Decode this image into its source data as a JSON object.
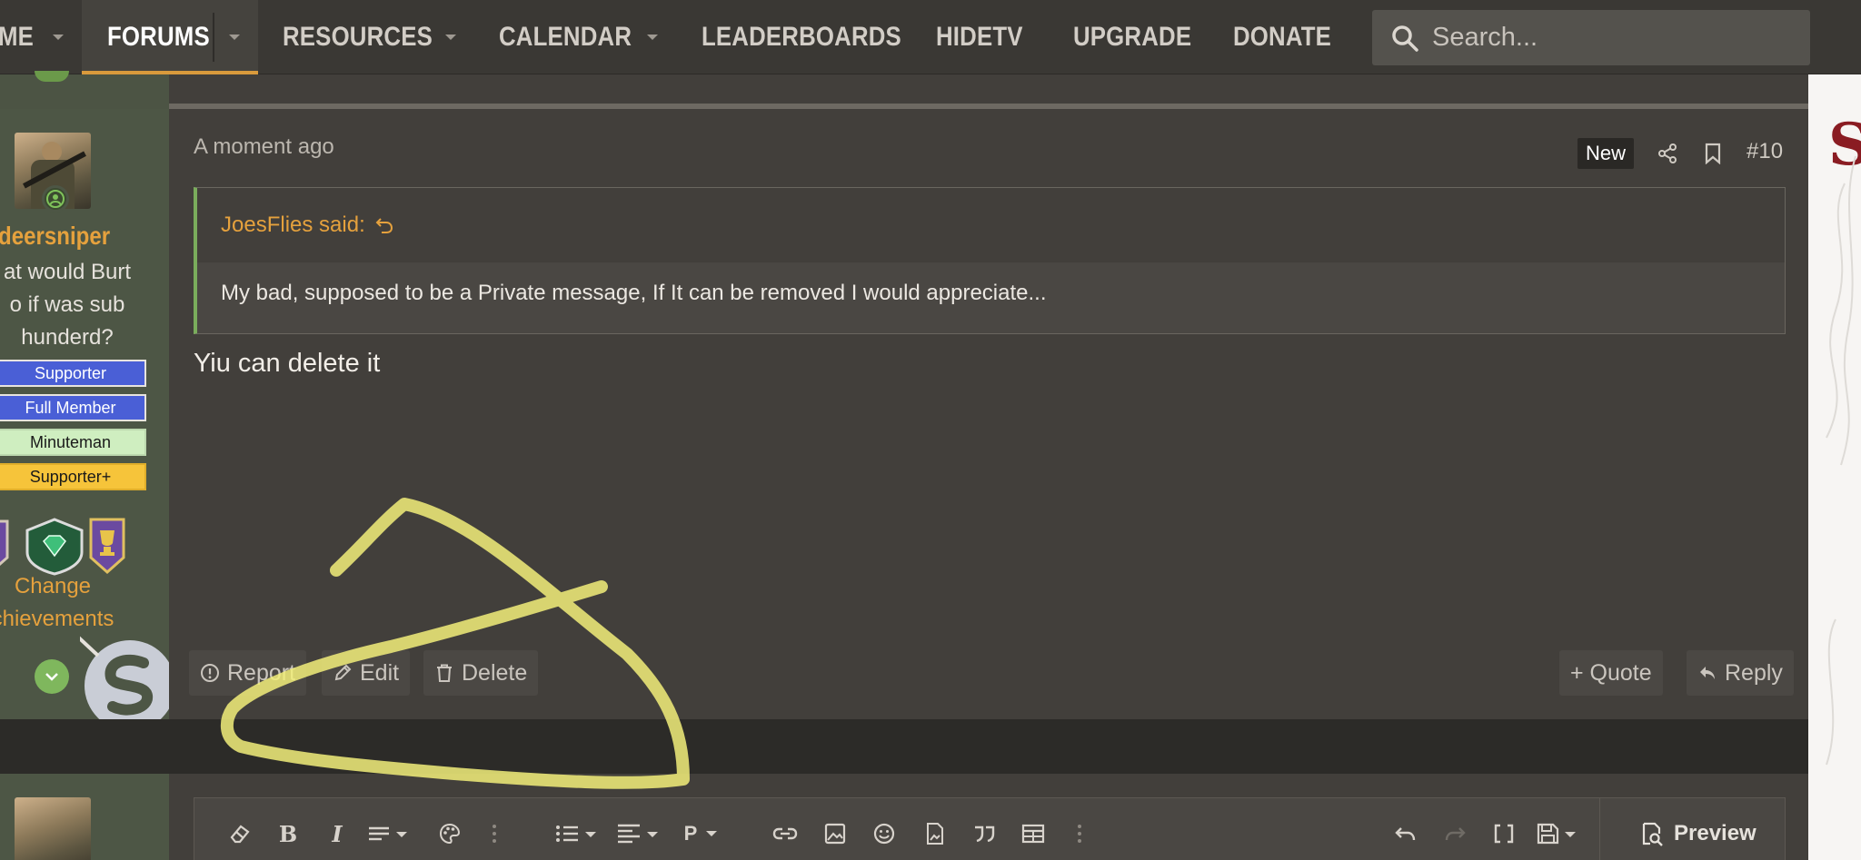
{
  "nav": {
    "items": [
      {
        "label": "ME"
      },
      {
        "label": "FORUMS"
      },
      {
        "label": "RESOURCES"
      },
      {
        "label": "CALENDAR"
      },
      {
        "label": "LEADERBOARDS"
      },
      {
        "label": "HIDETV"
      },
      {
        "label": "UPGRADE"
      },
      {
        "label": "DONATE"
      }
    ],
    "search_placeholder": "Search..."
  },
  "user": {
    "username": "deersniper",
    "title_lines": [
      "at would Burt",
      "o if was sub",
      "hunderd?"
    ],
    "banners": [
      {
        "label": "Supporter",
        "style": "blue"
      },
      {
        "label": "Full Member",
        "style": "blue"
      },
      {
        "label": "Minuteman",
        "style": "green"
      },
      {
        "label": "Supporter+",
        "style": "yellow"
      }
    ],
    "change_achievements_lines": [
      "Change",
      "chievements"
    ]
  },
  "post": {
    "timestamp": "A moment ago",
    "new_badge": "New",
    "number": "#10",
    "quote": {
      "author": "JoesFlies said:",
      "text": "My bad, supposed to be a Private message, If It can be removed I would appreciate..."
    },
    "message": "Yiu can delete it",
    "actions": {
      "report": "Report",
      "edit": "Edit",
      "delete": "Delete",
      "quote": "+ Quote",
      "reply": "Reply"
    }
  },
  "editor": {
    "preview_label": "Preview",
    "bold_glyph": "B",
    "italic_glyph": "I",
    "paragraph_glyph": "P"
  },
  "colors": {
    "accent": "#d99a3c",
    "username": "#e5a13d",
    "online": "#6b9a4a",
    "highlight": "#f2ee7a"
  }
}
